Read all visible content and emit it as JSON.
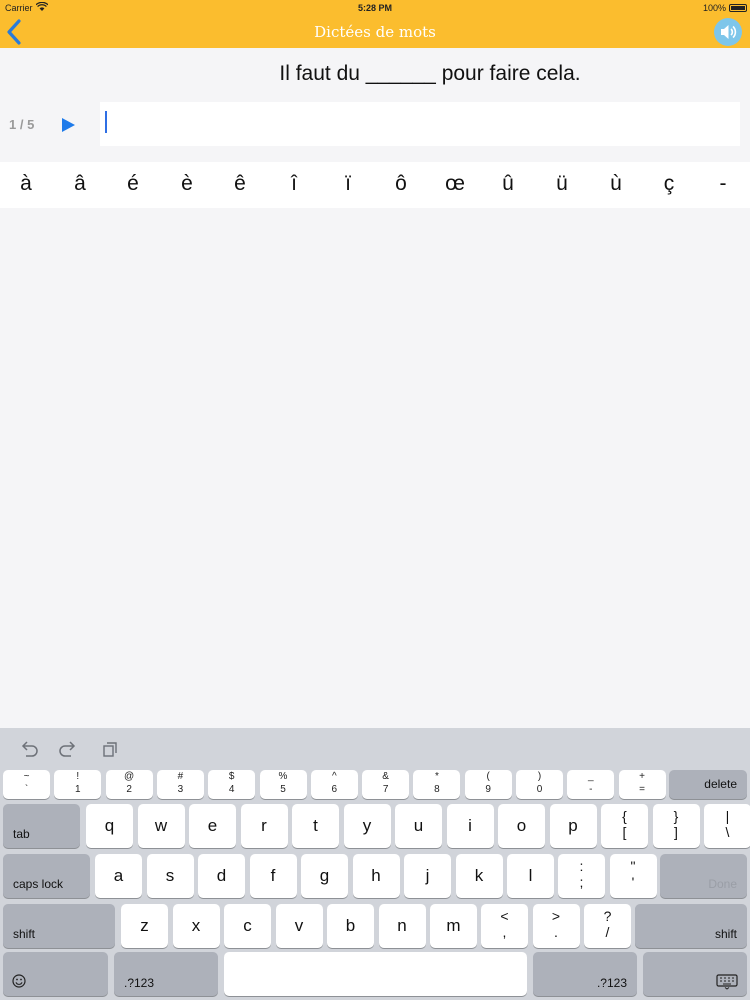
{
  "status_bar": {
    "carrier": "Carrier",
    "time": "5:28 PM",
    "battery": "100%"
  },
  "nav": {
    "title": "Dictées de mots",
    "back_icon": "chevron-left-icon",
    "sound_icon": "speaker-icon"
  },
  "exercise": {
    "sentence": "Il faut du ______ pour faire cela.",
    "counter": "1 / 5",
    "answer_value": "",
    "accent_chars": [
      "à",
      "â",
      "é",
      "è",
      "ê",
      "î",
      "ï",
      "ô",
      "œ",
      "û",
      "ü",
      "ù",
      "ç",
      "-"
    ]
  },
  "keyboard": {
    "number_row": [
      {
        "top": "~",
        "bottom": "`"
      },
      {
        "top": "!",
        "bottom": "1"
      },
      {
        "top": "@",
        "bottom": "2"
      },
      {
        "top": "#",
        "bottom": "3"
      },
      {
        "top": "$",
        "bottom": "4"
      },
      {
        "top": "%",
        "bottom": "5"
      },
      {
        "top": "^",
        "bottom": "6"
      },
      {
        "top": "&",
        "bottom": "7"
      },
      {
        "top": "*",
        "bottom": "8"
      },
      {
        "top": "(",
        "bottom": "9"
      },
      {
        "top": ")",
        "bottom": "0"
      },
      {
        "top": "_",
        "bottom": "-"
      },
      {
        "top": "+",
        "bottom": "="
      }
    ],
    "delete": "delete",
    "tab": "tab",
    "row1": [
      "q",
      "w",
      "e",
      "r",
      "t",
      "y",
      "u",
      "i",
      "o",
      "p"
    ],
    "row1_symbols": [
      {
        "top": "{",
        "bottom": "["
      },
      {
        "top": "}",
        "bottom": "]"
      },
      {
        "top": "|",
        "bottom": "\\"
      }
    ],
    "caps_lock": "caps lock",
    "row2": [
      "a",
      "s",
      "d",
      "f",
      "g",
      "h",
      "j",
      "k",
      "l"
    ],
    "row2_symbols": [
      {
        "top": ":",
        "bottom": ";"
      },
      {
        "top": "\"",
        "bottom": "'"
      }
    ],
    "done": "Done",
    "shift": "shift",
    "row3": [
      "z",
      "x",
      "c",
      "v",
      "b",
      "n",
      "m"
    ],
    "row3_symbols": [
      {
        "top": "<",
        "bottom": ","
      },
      {
        "top": ">",
        "bottom": "."
      },
      {
        "top": "?",
        "bottom": "/"
      }
    ],
    "numbers_key": ".?123",
    "emoji_icon": "emoji-icon",
    "dismiss_icon": "keyboard-dismiss-icon"
  }
}
